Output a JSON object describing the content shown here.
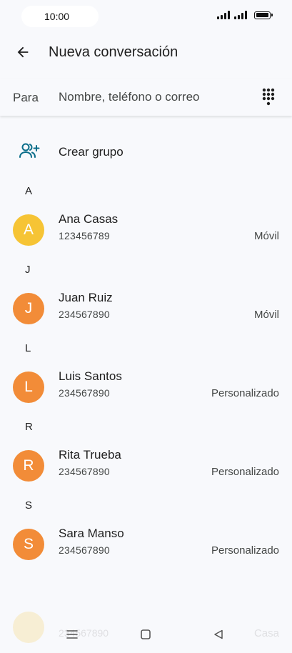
{
  "status_bar": {
    "time": "10:00"
  },
  "header": {
    "title": "Nueva conversación"
  },
  "recipient": {
    "label": "Para",
    "placeholder": "Nombre, teléfono o correo"
  },
  "create_group": {
    "label": "Crear grupo"
  },
  "sections": [
    {
      "letter": "A",
      "contact": {
        "initial": "A",
        "name": "Ana Casas",
        "number": "123456789",
        "type": "Móvil",
        "avatar_color": "#f6c435"
      }
    },
    {
      "letter": "J",
      "contact": {
        "initial": "J",
        "name": "Juan Ruiz",
        "number": "234567890",
        "type": "Móvil",
        "avatar_color": "#f28c38"
      }
    },
    {
      "letter": "L",
      "contact": {
        "initial": "L",
        "name": "Luis Santos",
        "number": "234567890",
        "type": "Personalizado",
        "avatar_color": "#f28c38"
      }
    },
    {
      "letter": "R",
      "contact": {
        "initial": "R",
        "name": "Rita Trueba",
        "number": "234567890",
        "type": "Personalizado",
        "avatar_color": "#f28c38"
      }
    },
    {
      "letter": "S",
      "contact": {
        "initial": "S",
        "name": "Sara Manso",
        "number": "234567890",
        "type": "Personalizado",
        "avatar_color": "#f28c38"
      }
    }
  ],
  "ghost_row": {
    "number": "234567890",
    "type": "Casa"
  },
  "colors": {
    "accent": "#0b6e8a",
    "background": "#f8f9fc"
  },
  "icons": {
    "back": "arrow-left-icon",
    "dialpad": "dialpad-icon",
    "group": "add-group-icon",
    "nav_menu": "menu-icon",
    "nav_home": "home-square-icon",
    "nav_back": "back-triangle-icon"
  }
}
